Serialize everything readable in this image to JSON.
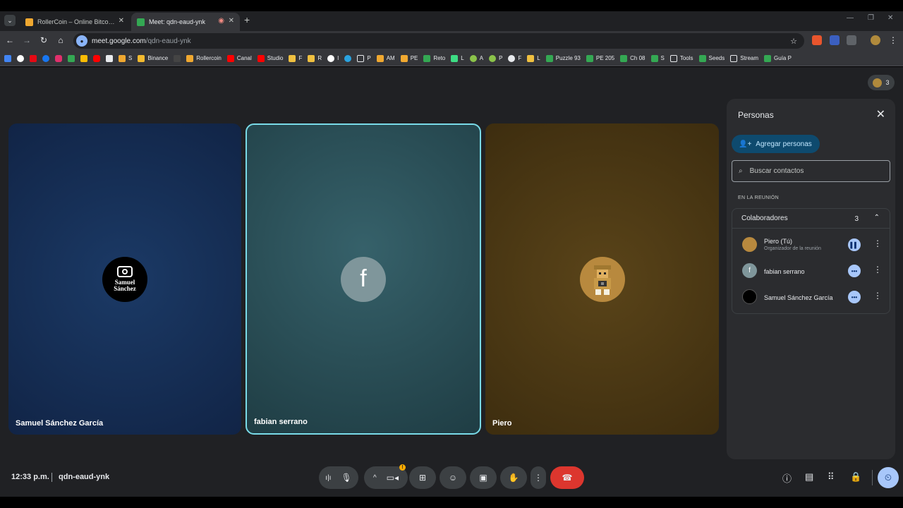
{
  "browser": {
    "tabs": [
      {
        "title": "RollerCoin – Online Bitcoin Mi...",
        "favicon_color": "#f0a830",
        "active": false
      },
      {
        "title": "Meet: qdn-eaud-ynk",
        "favicon_color": "#34a853",
        "active": true
      }
    ],
    "url_host": "meet.google.com",
    "url_path": "/qdn-eaud-ynk",
    "bookmarks": [
      "S",
      "Binance",
      "Rollercoin",
      "Canal",
      "Studio",
      "F",
      "R",
      "I",
      "P",
      "AM",
      "PE",
      "Reto",
      "L",
      "A",
      "P",
      "F",
      "L",
      "Puzzle 93",
      "PE 205",
      "Ch 08",
      "S",
      "Tools",
      "Seeds",
      "Stream",
      "Guía P"
    ]
  },
  "meeting": {
    "participant_count": "3",
    "time": "12:33 p.m.",
    "code": "qdn-eaud-ynk"
  },
  "tiles": [
    {
      "name": "Samuel Sánchez García",
      "avatar_text": "Samuel Sánchez"
    },
    {
      "name": "fabian serrano",
      "avatar_letter": "f"
    },
    {
      "name": "Piero"
    }
  ],
  "panel": {
    "title": "Personas",
    "add_label": "Agregar personas",
    "search_placeholder": "Buscar contactos",
    "section_label": "EN LA REUNIÓN",
    "group_label": "Colaboradores",
    "group_count": "3",
    "people": [
      {
        "name": "Piero (Tú)",
        "subtitle": "Organizador de la reunión",
        "avatar_color": "#b8893e"
      },
      {
        "name": "fabian serrano",
        "avatar_letter": "f",
        "avatar_color": "#7f969b"
      },
      {
        "name": "Samuel Sánchez García",
        "avatar_color": "#000000"
      }
    ]
  },
  "colors": {
    "accent_border": "#79dbe8",
    "end_call": "#dc362e",
    "add_button_bg": "#0e4a6e",
    "status_badge": "#a8c7fa"
  }
}
